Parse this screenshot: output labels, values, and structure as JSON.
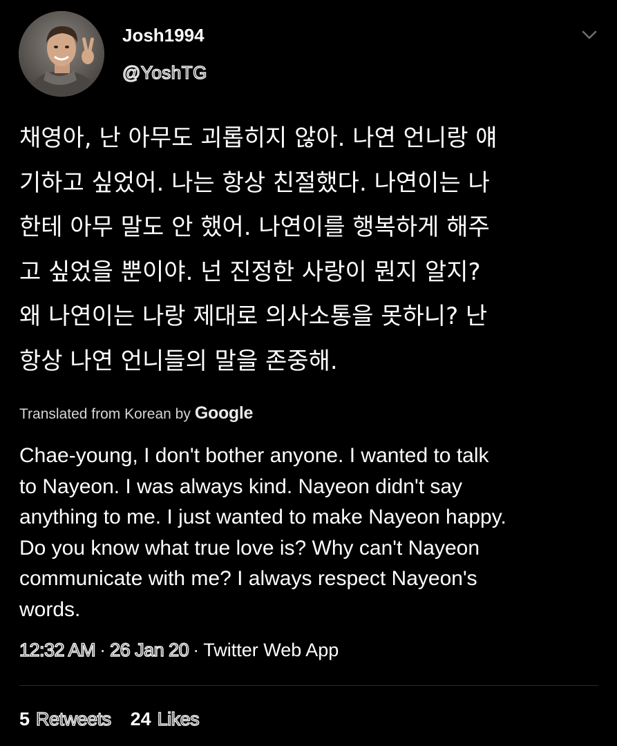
{
  "author": {
    "display_name": "Josh1994",
    "handle": "@YoshTG",
    "avatar": "profile-photo"
  },
  "menu_icon": "chevron-down-icon",
  "tweet": {
    "original_text": "채영아, 난 아무도 괴롭히지 않아. 나연 언니랑 얘\n기하고 싶었어. 나는 항상 친절했다. 나연이는 나\n한테 아무 말도 안 했어. 나연이를 행복하게 해주\n고 싶었을 뿐이야.  넌 진정한 사랑이 뭔지 알지?\n왜 나연이는 나랑 제대로 의사소통을 못하니? 난\n항상 나연 언니들의 말을 존중해.",
    "translated_label": "Translated from Korean by",
    "translation_provider": "Google",
    "translation_text": "Chae-young, I don't bother anyone. I wanted to talk\nto Nayeon. I was always kind. Nayeon didn't say\nanything to me. I just wanted to make Nayeon happy.\nDo you know what true love is? Why can't Nayeon\ncommunicate with me? I always respect Nayeon's\nwords."
  },
  "meta": {
    "time": "12:32 AM",
    "date": "26 Jan 20",
    "separator": "·",
    "source": "Twitter Web App"
  },
  "stats": {
    "retweets_count": "5",
    "retweets_label": "Retweets",
    "likes_count": "24",
    "likes_label": "Likes"
  },
  "colors": {
    "background": "#000000",
    "text": "#ffffff",
    "secondary": "#d6d6d6",
    "divider": "#2a2a2a"
  }
}
